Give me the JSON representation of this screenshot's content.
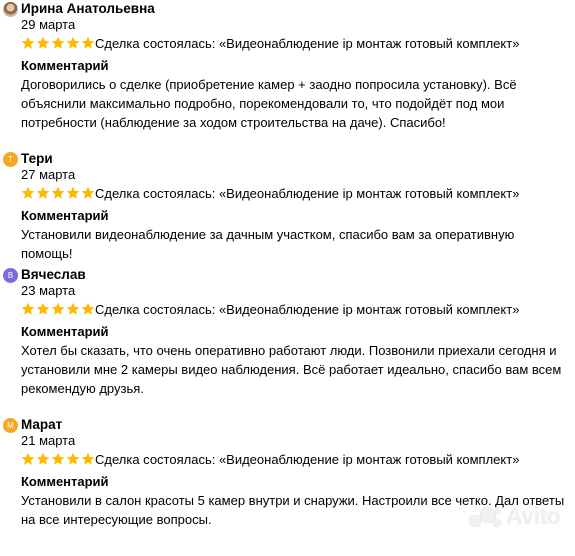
{
  "reviews": [
    {
      "avatar_letter": "",
      "avatar_type": "photo",
      "name": "Ирина Анатольевна",
      "date": "29 марта",
      "rating": 5,
      "deal": "Сделка состоялась: «Видеонаблюдение ip монтаж готовый комплект»",
      "comment_title": "Комментарий",
      "comment": "Договорились о сделке (приобретение камер + заодно попросила установку). Всё объяснили максимально подробно, порекомендовали то, что подойдёт под мои потребности (наблюдение за ходом строительства на даче). Спасибо!"
    },
    {
      "avatar_letter": "Т",
      "avatar_type": "letter",
      "avatar_color": "#f5a623",
      "name": "Тери",
      "date": "27 марта",
      "rating": 5,
      "deal": "Сделка состоялась: «Видеонаблюдение ip монтаж готовый комплект»",
      "comment_title": "Комментарий",
      "comment": "Установили видеонаблюдение за дачным участком, спасибо вам за оперативную помощь!"
    },
    {
      "avatar_letter": "В",
      "avatar_type": "letter",
      "avatar_color": "#7b6cd9",
      "name": "Вячеслав",
      "date": "23 марта",
      "rating": 5,
      "deal": "Сделка состоялась: «Видеонаблюдение ip монтаж готовый комплект»",
      "comment_title": "Комментарий",
      "comment": "Хотел бы сказать, что очень оперативно работают люди. Позвонили приехали сегодня и установили мне 2 камеры видео наблюдения. Всё работает идеально, спасибо вам всем рекомендую друзья."
    },
    {
      "avatar_letter": "М",
      "avatar_type": "letter",
      "avatar_color": "#f5a623",
      "name": "Марат",
      "date": "21 марта",
      "rating": 5,
      "deal": "Сделка состоялась: «Видеонаблюдение ip монтаж готовый комплект»",
      "comment_title": "Комментарий",
      "comment": "Установили в салон красоты 5 камер внутри и снаружи. Настроили все четко. Дал ответы на все интересующие вопросы."
    }
  ],
  "watermark": "Avito",
  "colors": {
    "star": "#ffb800",
    "text": "#000000"
  }
}
